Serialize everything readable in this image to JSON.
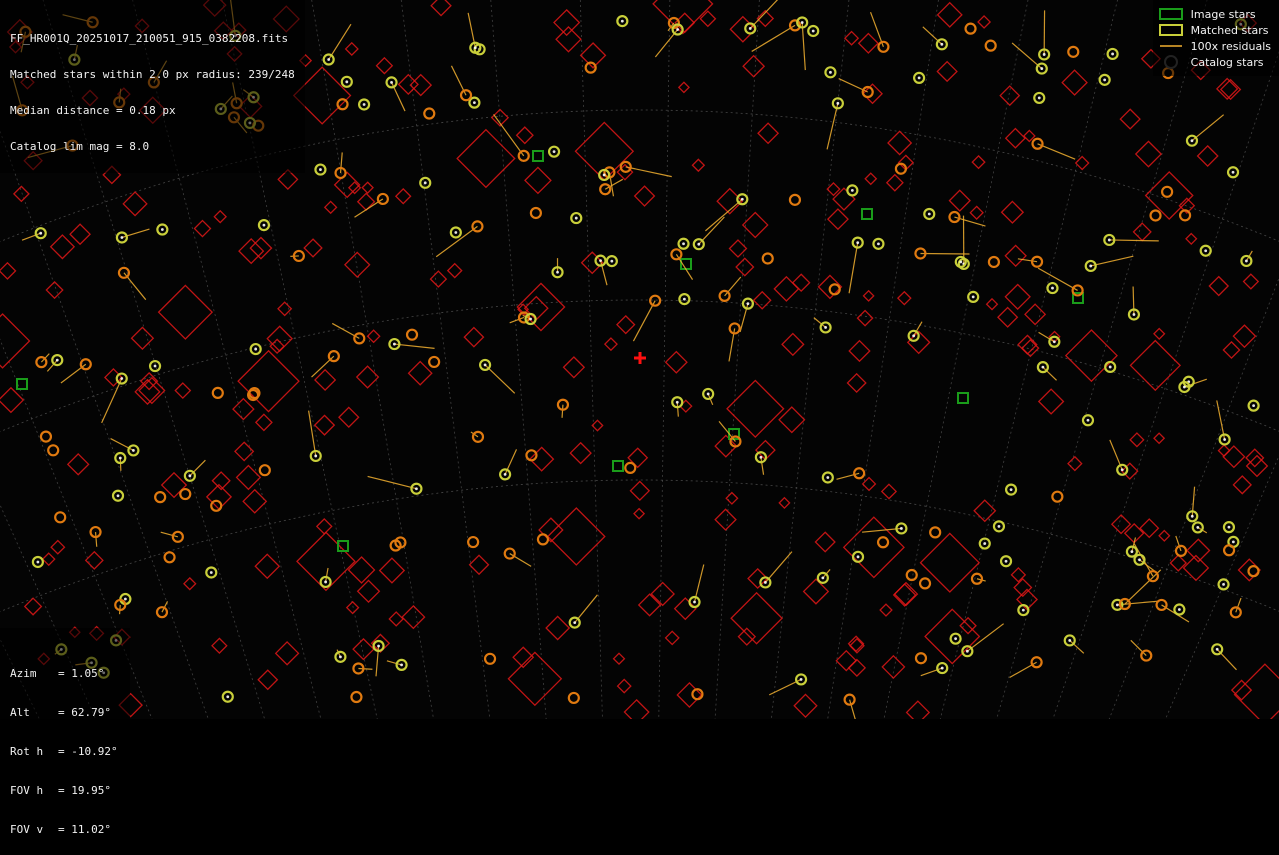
{
  "info": {
    "filename": "FF_HR001Q_20251017_210051_915_0382208.fits",
    "matched": "Matched stars within 2.0 px radius: 239/248",
    "median": "Median distance = 0.18 px",
    "limmag": "Catalog lim mag = 8.0"
  },
  "legend": {
    "image_stars": "Image stars",
    "matched_stars": "Matched stars",
    "residuals": "100x residuals",
    "catalog_stars": "Catalog stars"
  },
  "pointing": [
    {
      "key": "Azim",
      "sep": "=",
      "value": "1.05°"
    },
    {
      "key": "Alt",
      "sep": "=",
      "value": "62.79°"
    },
    {
      "key": "Rot h",
      "sep": "=",
      "value": "-10.92°"
    },
    {
      "key": "FOV h",
      "sep": "=",
      "value": "19.95°"
    },
    {
      "key": "FOV v",
      "sep": "=",
      "value": "11.02°"
    }
  ],
  "colors": {
    "image_star": "#1a9c1a",
    "matched_star": "#c9cf3a",
    "residual": "#f2b030",
    "catalog_star": "#e01818",
    "center_marker": "#ff1010",
    "grid": "#8a8a8a"
  }
}
